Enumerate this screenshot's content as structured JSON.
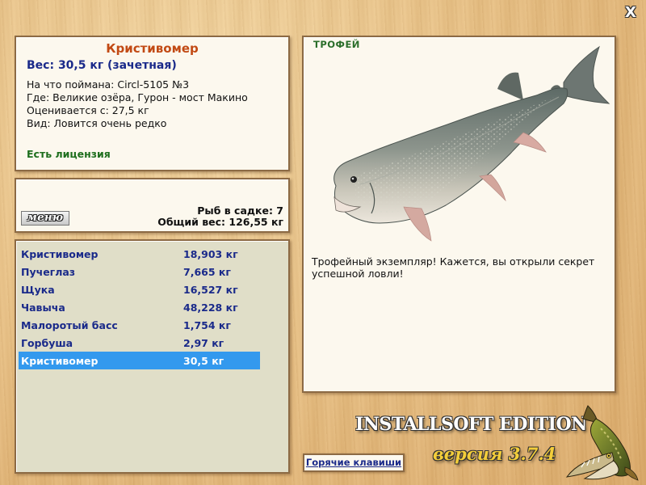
{
  "window": {
    "close_label": "X"
  },
  "info": {
    "fish_name": "Кристивомер",
    "weight_line": "Вес: 30,5 кг (зачетная)",
    "caught_with": "На что поймана: Circl-5105 №3",
    "location": "Где: Великие озёра, Гурон - мост Макино",
    "valued_from": "Оценивается с: 27,5 кг",
    "rarity": "Вид: Ловится очень редко",
    "license": "Есть лицензия"
  },
  "keepnet": {
    "menu_label": "меню",
    "fish_count": "Рыб в садке: 7",
    "total_weight": "Общий вес: 126,55 кг"
  },
  "catch_list": [
    {
      "name": "Кристивомер",
      "weight": "18,903 кг",
      "selected": false
    },
    {
      "name": "Пучеглаз",
      "weight": "7,665 кг",
      "selected": false
    },
    {
      "name": "Щука",
      "weight": "16,527 кг",
      "selected": false
    },
    {
      "name": "Чавыча",
      "weight": "48,228 кг",
      "selected": false
    },
    {
      "name": "Малоротый басс",
      "weight": "1,754 кг",
      "selected": false
    },
    {
      "name": "Горбуша",
      "weight": "2,97 кг",
      "selected": false
    },
    {
      "name": "Кристивомер",
      "weight": "30,5 кг",
      "selected": true
    }
  ],
  "trophy": {
    "label": "ТРОФЕЙ",
    "message": "Трофейный экземпляр! Кажется, вы открыли секрет успешной ловли!"
  },
  "footer": {
    "hotkeys_label": "Горячие клавиши",
    "brand": "INSTALLSOFT EDITION",
    "version": "версия 3.7.4"
  },
  "colors": {
    "accent_title": "#c24a14",
    "text_blue": "#1a2a8a",
    "license_green": "#1d6e1d",
    "selection": "#3399ee"
  }
}
